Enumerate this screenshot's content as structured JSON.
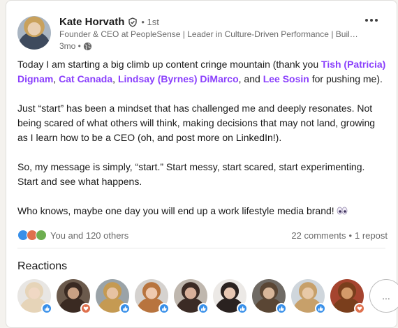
{
  "post": {
    "author": {
      "name": "Kate Horvath",
      "degree": "• 1st",
      "headline": "Founder & CEO at PeopleSense | Leader in Culture-Driven Performance | Build...",
      "time": "3mo •"
    },
    "paragraphs": {
      "p1_a": "Today I am starting a big climb up content cringe mountain (thank you ",
      "mention_1": "Tish (Patricia) Dignam",
      "sep_1": ", ",
      "mention_2": "Cat Canada",
      "sep_2": ", ",
      "mention_3": "Lindsay (Byrnes) DiMarco",
      "sep_3": ", and ",
      "mention_4": "Lee Sosin",
      "p1_b": " for pushing me).",
      "p2": "Just “start” has been a mindset that has challenged me and deeply resonates. Not being scared of what others will think, making decisions that may not land, growing as I learn how to be a CEO (oh, and post more on LinkedIn!).",
      "p3": "So, my message is simply, “start.” Start messy, start scared, start experimenting. Start and see what happens.",
      "p4": "Who knows, maybe one day you will end up a work lifestyle media brand!"
    },
    "social": {
      "reactions_text": "You and 120 others",
      "comments": "22 comments",
      "separator": "•",
      "reposts": "1 repost"
    },
    "reactions_section": {
      "title": "Reactions",
      "more_label": "..."
    }
  },
  "reactors": [
    {
      "reaction": "like",
      "skin": "#f0d8c4",
      "hair": "#e6d4b8",
      "bg": "#e8e6e3"
    },
    {
      "reaction": "love",
      "skin": "#c9a184",
      "hair": "#3a2a22",
      "bg": "#6b5a4c"
    },
    {
      "reaction": "like",
      "skin": "#e6c2a2",
      "hair": "#c59a52",
      "bg": "#9aa3a8"
    },
    {
      "reaction": "like",
      "skin": "#efc9ae",
      "hair": "#b8743e",
      "bg": "#d5d2cf"
    },
    {
      "reaction": "like",
      "skin": "#d8b09a",
      "hair": "#3b2b25",
      "bg": "#bfb7ae"
    },
    {
      "reaction": "like",
      "skin": "#e7c7b3",
      "hair": "#2a2220",
      "bg": "#ece9e6"
    },
    {
      "reaction": "like",
      "skin": "#d8b79a",
      "hair": "#5a4634",
      "bg": "#6f6a64"
    },
    {
      "reaction": "like",
      "skin": "#e8c9a8",
      "hair": "#c7a06a",
      "bg": "#cfd6dc"
    },
    {
      "reaction": "love",
      "skin": "#d49a6a",
      "hair": "#7a3e1c",
      "bg": "#a5442f"
    }
  ],
  "colors": {
    "mention": "#8a3ffc",
    "like": "#378fe9",
    "love": "#df704d",
    "support": "#6dae4f"
  }
}
